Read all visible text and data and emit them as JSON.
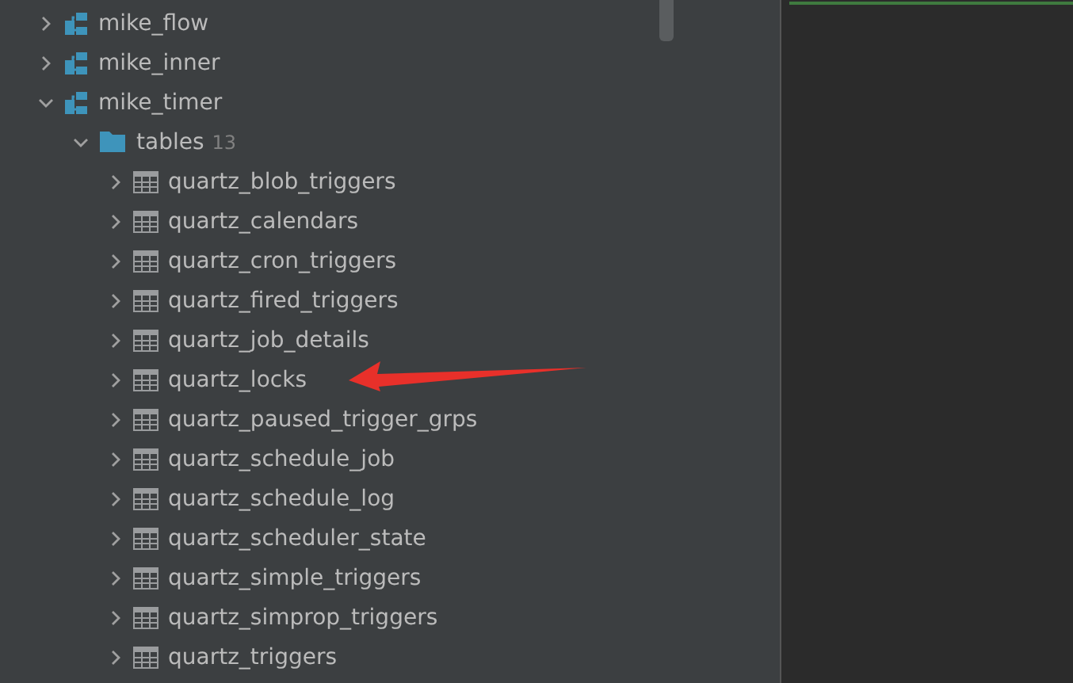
{
  "tree": [
    {
      "kind": "schema",
      "label": "mike_flow",
      "expanded": false
    },
    {
      "kind": "schema",
      "label": "mike_inner",
      "expanded": false
    },
    {
      "kind": "schema",
      "label": "mike_timer",
      "expanded": true,
      "children": [
        {
          "kind": "folder",
          "label": "tables",
          "count": "13",
          "expanded": true,
          "children": [
            {
              "kind": "table",
              "label": "quartz_blob_triggers",
              "expanded": false
            },
            {
              "kind": "table",
              "label": "quartz_calendars",
              "expanded": false
            },
            {
              "kind": "table",
              "label": "quartz_cron_triggers",
              "expanded": false
            },
            {
              "kind": "table",
              "label": "quartz_fired_triggers",
              "expanded": false
            },
            {
              "kind": "table",
              "label": "quartz_job_details",
              "expanded": false
            },
            {
              "kind": "table",
              "label": "quartz_locks",
              "expanded": false
            },
            {
              "kind": "table",
              "label": "quartz_paused_trigger_grps",
              "expanded": false
            },
            {
              "kind": "table",
              "label": "quartz_schedule_job",
              "expanded": false
            },
            {
              "kind": "table",
              "label": "quartz_schedule_log",
              "expanded": false
            },
            {
              "kind": "table",
              "label": "quartz_scheduler_state",
              "expanded": false
            },
            {
              "kind": "table",
              "label": "quartz_simple_triggers",
              "expanded": false
            },
            {
              "kind": "table",
              "label": "quartz_simprop_triggers",
              "expanded": false
            },
            {
              "kind": "table",
              "label": "quartz_triggers",
              "expanded": false
            }
          ]
        }
      ]
    }
  ]
}
